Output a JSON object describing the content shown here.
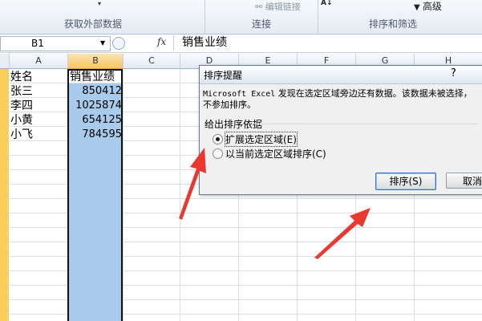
{
  "ribbon": {
    "groups": [
      "获取外部数据",
      "连接",
      "排序和筛选"
    ],
    "edit_links_label": "编辑链接",
    "advanced_label": "高级",
    "sort_glyph": "A↓"
  },
  "formula_bar": {
    "name_box": "B1",
    "fx_label": "fx",
    "content": "销售业绩"
  },
  "columns": [
    "A",
    "B",
    "C",
    "D",
    "E",
    "F",
    "G",
    "H"
  ],
  "sheet": {
    "header_a": "姓名",
    "header_b": "销售业绩",
    "rows": [
      {
        "name": "张三",
        "value": "850412"
      },
      {
        "name": "李四",
        "value": "1025874"
      },
      {
        "name": "小黄",
        "value": "654125"
      },
      {
        "name": "小飞",
        "value": "784595"
      }
    ]
  },
  "dialog": {
    "title": "排序提醒",
    "help": "?",
    "message_latin": "Microsoft Excel",
    "message_rest": " 发现在选定区域旁边还有数据。该数据未被选择，",
    "message_line2": "不参加排序。",
    "section_label": "给出排序依据",
    "option_expand": "扩展选定区域(E)",
    "option_current": "以当前选定区域排序(C)",
    "sort_button": "排序(S)",
    "cancel_button": "取消"
  },
  "colors": {
    "selection": "#a8cbeb",
    "arrow": "#e8382f",
    "row_header": "#f7cf5a"
  }
}
